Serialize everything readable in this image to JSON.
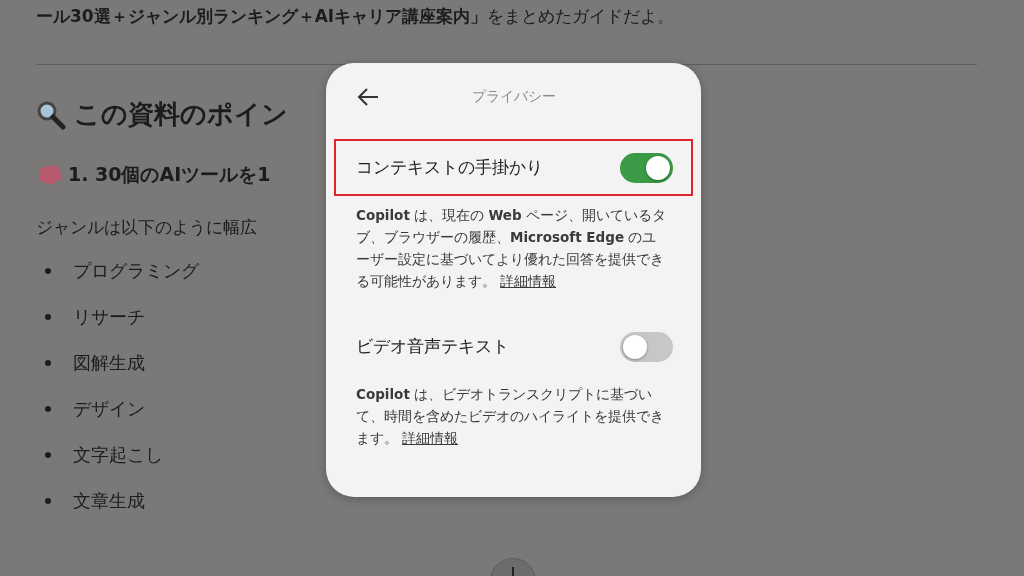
{
  "article": {
    "intro": "**ール30選＋ジャンル別ランキング＋AIキャリア講座案内」**をまとめたガイドだよ。",
    "heading": "この資料のポイン",
    "subheading": "1. 30個のAIツールを1",
    "paragraph": "ジャンルは以下のように幅広",
    "list": [
      "プログラミング",
      "リサーチ",
      "図解生成",
      "デザイン",
      "文字起こし",
      "文章生成"
    ]
  },
  "dialog": {
    "title": "プライバシー",
    "settings": [
      {
        "label": "コンテキストの手掛かり",
        "on": true,
        "highlighted": true,
        "description": "**Copilot** は、現在の **Web** ページ、開いているタブ、ブラウザーの履歴、**Microsoft Edge** のユーザー設定に基づいてより優れた回答を提供できる可能性があります。",
        "link": "詳細情報"
      },
      {
        "label": "ビデオ音声テキスト",
        "on": false,
        "highlighted": false,
        "description": "**Copilot** は、ビデオトランスクリプトに基づいて、時間を含めたビデオのハイライトを提供できます。",
        "link": "詳細情報"
      }
    ]
  }
}
